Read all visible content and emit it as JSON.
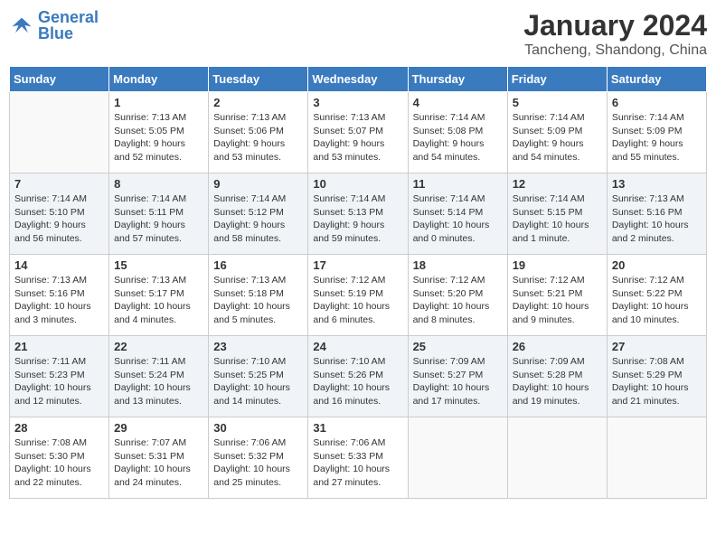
{
  "header": {
    "logo_text_general": "General",
    "logo_text_blue": "Blue",
    "title": "January 2024",
    "subtitle": "Tancheng, Shandong, China"
  },
  "weekdays": [
    "Sunday",
    "Monday",
    "Tuesday",
    "Wednesday",
    "Thursday",
    "Friday",
    "Saturday"
  ],
  "weeks": [
    [
      {
        "num": "",
        "info": ""
      },
      {
        "num": "1",
        "info": "Sunrise: 7:13 AM\nSunset: 5:05 PM\nDaylight: 9 hours\nand 52 minutes."
      },
      {
        "num": "2",
        "info": "Sunrise: 7:13 AM\nSunset: 5:06 PM\nDaylight: 9 hours\nand 53 minutes."
      },
      {
        "num": "3",
        "info": "Sunrise: 7:13 AM\nSunset: 5:07 PM\nDaylight: 9 hours\nand 53 minutes."
      },
      {
        "num": "4",
        "info": "Sunrise: 7:14 AM\nSunset: 5:08 PM\nDaylight: 9 hours\nand 54 minutes."
      },
      {
        "num": "5",
        "info": "Sunrise: 7:14 AM\nSunset: 5:09 PM\nDaylight: 9 hours\nand 54 minutes."
      },
      {
        "num": "6",
        "info": "Sunrise: 7:14 AM\nSunset: 5:09 PM\nDaylight: 9 hours\nand 55 minutes."
      }
    ],
    [
      {
        "num": "7",
        "info": "Sunrise: 7:14 AM\nSunset: 5:10 PM\nDaylight: 9 hours\nand 56 minutes."
      },
      {
        "num": "8",
        "info": "Sunrise: 7:14 AM\nSunset: 5:11 PM\nDaylight: 9 hours\nand 57 minutes."
      },
      {
        "num": "9",
        "info": "Sunrise: 7:14 AM\nSunset: 5:12 PM\nDaylight: 9 hours\nand 58 minutes."
      },
      {
        "num": "10",
        "info": "Sunrise: 7:14 AM\nSunset: 5:13 PM\nDaylight: 9 hours\nand 59 minutes."
      },
      {
        "num": "11",
        "info": "Sunrise: 7:14 AM\nSunset: 5:14 PM\nDaylight: 10 hours\nand 0 minutes."
      },
      {
        "num": "12",
        "info": "Sunrise: 7:14 AM\nSunset: 5:15 PM\nDaylight: 10 hours\nand 1 minute."
      },
      {
        "num": "13",
        "info": "Sunrise: 7:13 AM\nSunset: 5:16 PM\nDaylight: 10 hours\nand 2 minutes."
      }
    ],
    [
      {
        "num": "14",
        "info": "Sunrise: 7:13 AM\nSunset: 5:16 PM\nDaylight: 10 hours\nand 3 minutes."
      },
      {
        "num": "15",
        "info": "Sunrise: 7:13 AM\nSunset: 5:17 PM\nDaylight: 10 hours\nand 4 minutes."
      },
      {
        "num": "16",
        "info": "Sunrise: 7:13 AM\nSunset: 5:18 PM\nDaylight: 10 hours\nand 5 minutes."
      },
      {
        "num": "17",
        "info": "Sunrise: 7:12 AM\nSunset: 5:19 PM\nDaylight: 10 hours\nand 6 minutes."
      },
      {
        "num": "18",
        "info": "Sunrise: 7:12 AM\nSunset: 5:20 PM\nDaylight: 10 hours\nand 8 minutes."
      },
      {
        "num": "19",
        "info": "Sunrise: 7:12 AM\nSunset: 5:21 PM\nDaylight: 10 hours\nand 9 minutes."
      },
      {
        "num": "20",
        "info": "Sunrise: 7:12 AM\nSunset: 5:22 PM\nDaylight: 10 hours\nand 10 minutes."
      }
    ],
    [
      {
        "num": "21",
        "info": "Sunrise: 7:11 AM\nSunset: 5:23 PM\nDaylight: 10 hours\nand 12 minutes."
      },
      {
        "num": "22",
        "info": "Sunrise: 7:11 AM\nSunset: 5:24 PM\nDaylight: 10 hours\nand 13 minutes."
      },
      {
        "num": "23",
        "info": "Sunrise: 7:10 AM\nSunset: 5:25 PM\nDaylight: 10 hours\nand 14 minutes."
      },
      {
        "num": "24",
        "info": "Sunrise: 7:10 AM\nSunset: 5:26 PM\nDaylight: 10 hours\nand 16 minutes."
      },
      {
        "num": "25",
        "info": "Sunrise: 7:09 AM\nSunset: 5:27 PM\nDaylight: 10 hours\nand 17 minutes."
      },
      {
        "num": "26",
        "info": "Sunrise: 7:09 AM\nSunset: 5:28 PM\nDaylight: 10 hours\nand 19 minutes."
      },
      {
        "num": "27",
        "info": "Sunrise: 7:08 AM\nSunset: 5:29 PM\nDaylight: 10 hours\nand 21 minutes."
      }
    ],
    [
      {
        "num": "28",
        "info": "Sunrise: 7:08 AM\nSunset: 5:30 PM\nDaylight: 10 hours\nand 22 minutes."
      },
      {
        "num": "29",
        "info": "Sunrise: 7:07 AM\nSunset: 5:31 PM\nDaylight: 10 hours\nand 24 minutes."
      },
      {
        "num": "30",
        "info": "Sunrise: 7:06 AM\nSunset: 5:32 PM\nDaylight: 10 hours\nand 25 minutes."
      },
      {
        "num": "31",
        "info": "Sunrise: 7:06 AM\nSunset: 5:33 PM\nDaylight: 10 hours\nand 27 minutes."
      },
      {
        "num": "",
        "info": ""
      },
      {
        "num": "",
        "info": ""
      },
      {
        "num": "",
        "info": ""
      }
    ]
  ]
}
